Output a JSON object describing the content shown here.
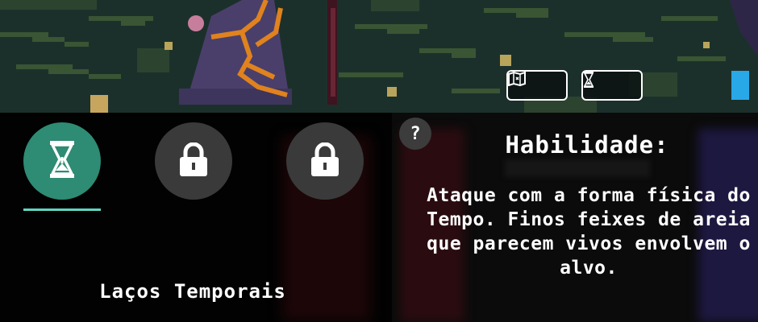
{
  "top_bar": {
    "map_button_icon": "map-icon",
    "time_button_icon": "hourglass-icon"
  },
  "abilities": {
    "slots": [
      {
        "icon": "hourglass-icon",
        "state": "selected",
        "color": "#2e8b74"
      },
      {
        "icon": "lock-icon",
        "state": "locked",
        "color": "#3a3a3a"
      },
      {
        "icon": "lock-icon",
        "state": "locked",
        "color": "#3a3a3a"
      }
    ],
    "selected_name": "Laços Temporais",
    "underline_color": "#5fd6c0"
  },
  "info": {
    "help_label": "?",
    "title": "Habilidade:",
    "description": "Ataque com a forma física do Tempo. Finos feixes de areia que parecem vivos envolvem o alvo."
  }
}
